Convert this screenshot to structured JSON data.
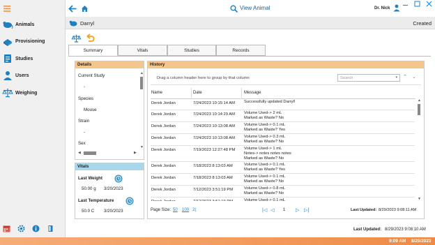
{
  "window": {
    "title": "View Animal",
    "user": "Dr. Nick"
  },
  "sidebar": {
    "items": [
      {
        "label": "Animals",
        "icon": "animals-icon"
      },
      {
        "label": "Provisioning",
        "icon": "provisioning-icon"
      },
      {
        "label": "Studies",
        "icon": "studies-icon"
      },
      {
        "label": "Users",
        "icon": "users-icon"
      },
      {
        "label": "Weighing",
        "icon": "scale-icon"
      }
    ],
    "bottom_icons": [
      "calendar-icon",
      "gear-icon",
      "info-icon",
      "document-icon"
    ]
  },
  "header": {
    "animal_name": "Darryl",
    "status": "Created"
  },
  "tabs": [
    "Summary",
    "Vitals",
    "Studies",
    "Records"
  ],
  "active_tab": "Summary",
  "details": {
    "title": "Details",
    "fields": [
      {
        "label": "Current Study",
        "value": "-"
      },
      {
        "label": "Species",
        "value": "Mouse"
      },
      {
        "label": "Strain",
        "value": "-"
      },
      {
        "label": "Sex",
        "value": ""
      }
    ]
  },
  "vitals": {
    "title": "Vitals",
    "last_weight": {
      "label": "Last Weight",
      "value": "50.00 g",
      "date": "3/20/2023"
    },
    "last_temperature": {
      "label": "Last Temperature",
      "value": "50.0 C",
      "date": "3/20/2023"
    }
  },
  "history": {
    "title": "History",
    "group_hint": "Drag a column header here to group by that column",
    "search_placeholder": "Search",
    "columns": [
      "Name",
      "Date",
      "Message"
    ],
    "rows": [
      {
        "name": "Derek Jordan",
        "date": "7/24/2023 10:15:14 AM",
        "message": [
          "Successfully updated Darryl!"
        ]
      },
      {
        "name": "Derek Jordan",
        "date": "7/24/2023 10:14:29 AM",
        "message": [
          "Volume Used-> 2 mL",
          "Marked as Waste? No"
        ]
      },
      {
        "name": "Derek Jordan",
        "date": "7/24/2023 10:13:08 AM",
        "message": [
          "Volume Used-> 0.1 mL",
          "Marked as Waste? Yes"
        ]
      },
      {
        "name": "Derek Jordan",
        "date": "7/24/2023 10:13:08 AM",
        "message": [
          "Volume Used-> 0.3 mL",
          "Marked as Waste? No"
        ]
      },
      {
        "name": "Derek Jordan",
        "date": "7/19/2023 12:27:48 PM",
        "message": [
          "Volume Used-> 1 mL",
          "Notes-> notes notes notes",
          "Marked as Waste? No"
        ]
      },
      {
        "name": "Derek Jordan",
        "date": "7/18/2023 8:13:03 AM",
        "message": [
          "Volume Used-> 0.1 mL",
          "Marked as Waste? Yes"
        ]
      },
      {
        "name": "Derek Jordan",
        "date": "7/18/2023 8:13:03 AM",
        "message": [
          "Volume Used-> 0.1 mL",
          "Marked as Waste? No"
        ]
      },
      {
        "name": "Derek Jordan",
        "date": "7/12/2023 3:51:19 PM",
        "message": [
          "Volume Used-> 0.8 mL",
          "Marked as Waste? No"
        ]
      },
      {
        "name": "Derek Jordan",
        "date": "7/12/2023 3:51:19 PM",
        "message": [
          "Volume Used-> 0.1 mL",
          "Marked as Waste? Yes"
        ]
      }
    ],
    "page_size_label": "Page Size:",
    "page_sizes": [
      "50",
      "100",
      "2("
    ],
    "current_page": "1",
    "last_updated_label": "Last Updated:",
    "last_updated_value": "8/29/2023 9:08:11 AM"
  },
  "footer": {
    "last_updated_label": "Last Updated:",
    "last_updated_value": "8/29/2023 9:08:10 AM"
  },
  "status_bar": {
    "time": "9:09 AM",
    "date": "8/29/2023"
  },
  "colors": {
    "accent_blue": "#1f7fc1",
    "details_header": "#f5c58e",
    "vitals_header": "#a9d6ea",
    "status_bar": "#f29a5c"
  }
}
